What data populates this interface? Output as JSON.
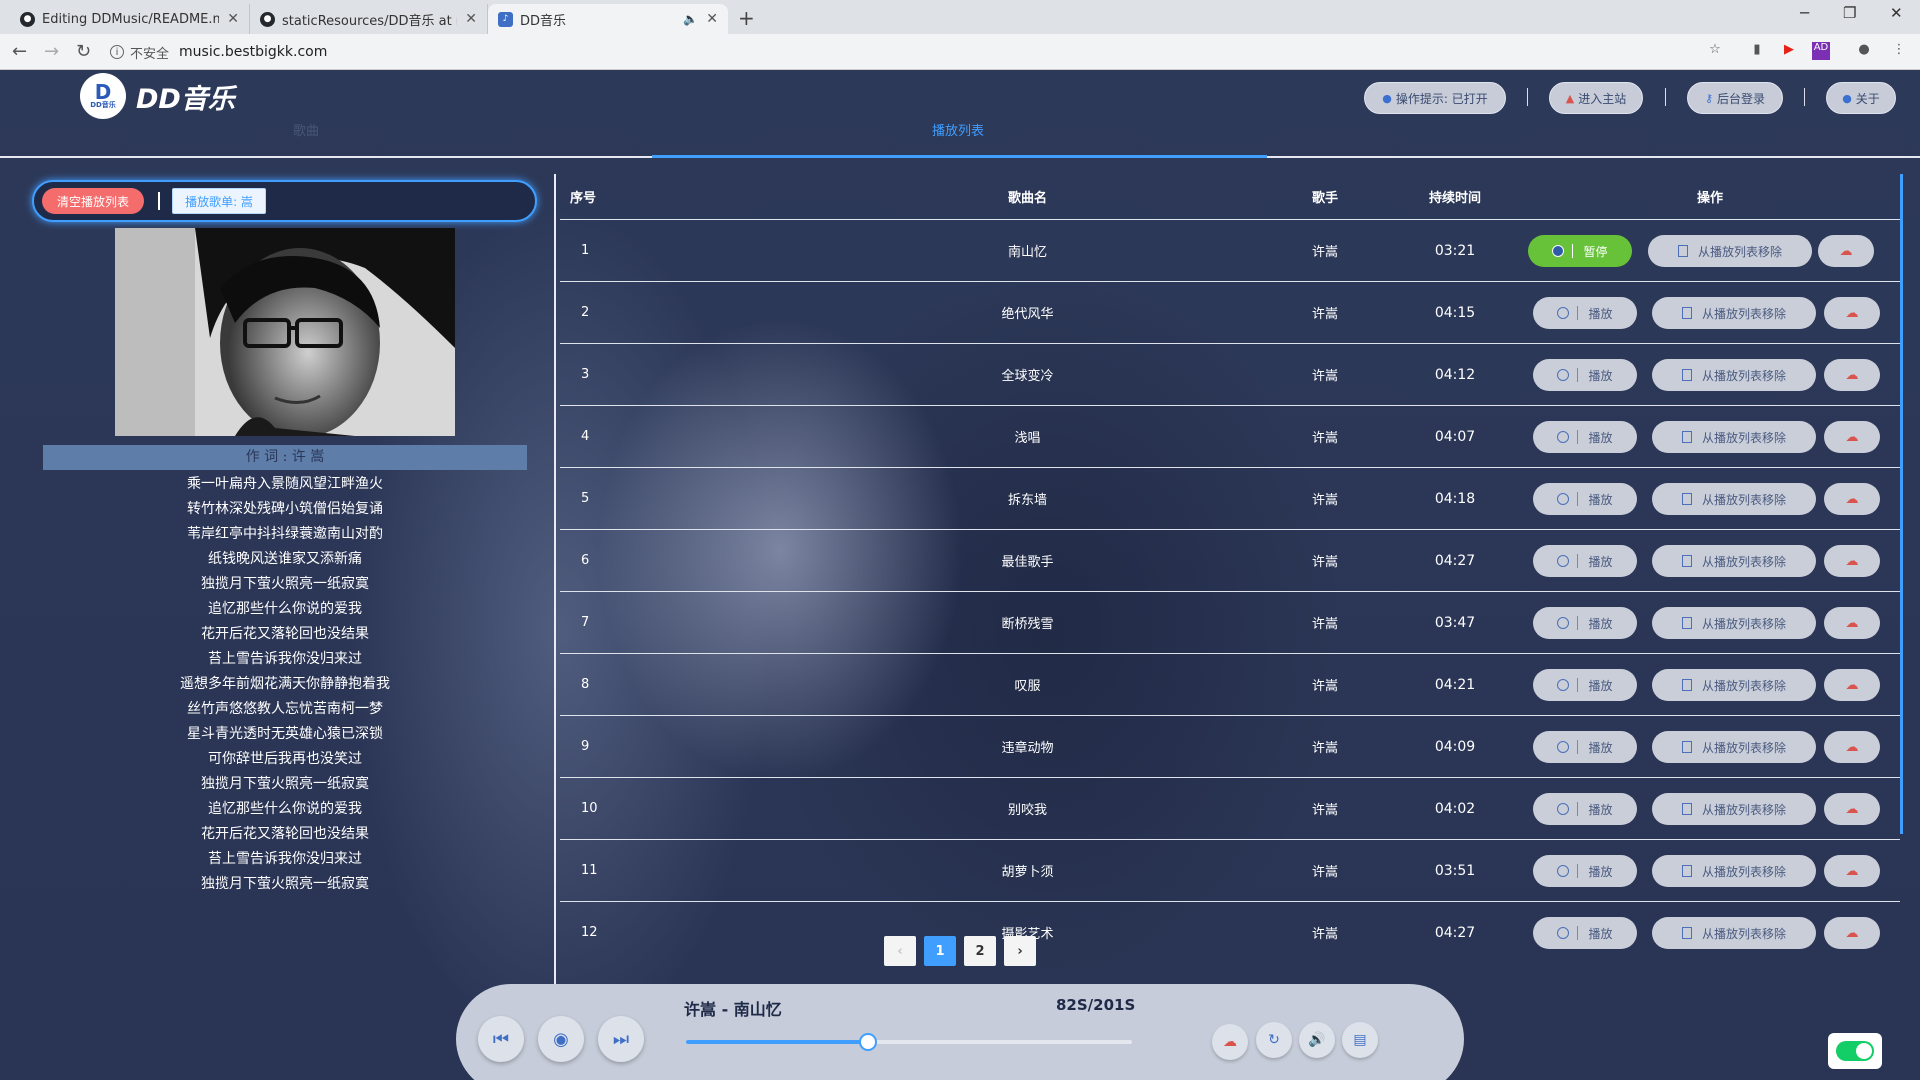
{
  "browser": {
    "tabs": [
      {
        "title": "Editing DDMusic/README.md at"
      },
      {
        "title": "staticResources/DD音乐 at maste"
      },
      {
        "title": "DD音乐"
      }
    ],
    "new_tab": "+",
    "insecure_label": "不安全",
    "url": "music.bestbigkk.com"
  },
  "header": {
    "logo_badge": "D",
    "logo_badge_small": "DD音乐",
    "logo_text": "DD音乐",
    "buttons": {
      "tips": "操作提示: 已打开",
      "main_site": "进入主站",
      "admin_login": "后台登录",
      "about": "关于"
    }
  },
  "nav": {
    "tab_lyrics": "歌曲",
    "tab_playlist": "播放列表"
  },
  "left": {
    "clear_button": "清空播放列表",
    "playlist_button": "播放歌单: 嵩",
    "lyric_header": "作 词 : 许 嵩",
    "lyrics": [
      "乘一叶扁舟入景随风望江畔渔火",
      "转竹林深处残碑小筑僧侣始复诵",
      "苇岸红亭中抖抖绿蓑邀南山对酌",
      "纸钱晚风送谁家又添新痛",
      "独揽月下萤火照亮一纸寂寞",
      "追忆那些什么你说的爱我",
      "花开后花又落轮回也没结果",
      "苔上雪告诉我你没归来过",
      "遥想多年前烟花满天你静静抱着我",
      "丝竹声悠悠教人忘忧苦南柯一梦",
      "星斗青光透时无英雄心猿已深锁",
      "可你辞世后我再也没笑过",
      "独揽月下萤火照亮一纸寂寞",
      "追忆那些什么你说的爱我",
      "花开后花又落轮回也没结果",
      "苔上雪告诉我你没归来过",
      "独揽月下萤火照亮一纸寂寞"
    ]
  },
  "table": {
    "headers": {
      "num": "序号",
      "name": "歌曲名",
      "singer": "歌手",
      "duration": "持续时间",
      "ops": "操作"
    },
    "play_label": "播放",
    "pause_label": "暂停",
    "remove_label": "从播放列表移除",
    "rows": [
      {
        "num": "1",
        "name": "南山忆",
        "singer": "许嵩",
        "duration": "03:21"
      },
      {
        "num": "2",
        "name": "绝代风华",
        "singer": "许嵩",
        "duration": "04:15"
      },
      {
        "num": "3",
        "name": "全球变冷",
        "singer": "许嵩",
        "duration": "04:12"
      },
      {
        "num": "4",
        "name": "浅唱",
        "singer": "许嵩",
        "duration": "04:07"
      },
      {
        "num": "5",
        "name": "拆东墙",
        "singer": "许嵩",
        "duration": "04:18"
      },
      {
        "num": "6",
        "name": "最佳歌手",
        "singer": "许嵩",
        "duration": "04:27"
      },
      {
        "num": "7",
        "name": "断桥残雪",
        "singer": "许嵩",
        "duration": "03:47"
      },
      {
        "num": "8",
        "name": "叹服",
        "singer": "许嵩",
        "duration": "04:21"
      },
      {
        "num": "9",
        "name": "违章动物",
        "singer": "许嵩",
        "duration": "04:09"
      },
      {
        "num": "10",
        "name": "别咬我",
        "singer": "许嵩",
        "duration": "04:02"
      },
      {
        "num": "11",
        "name": "胡萝卜须",
        "singer": "许嵩",
        "duration": "03:51"
      },
      {
        "num": "12",
        "name": "摄影艺术",
        "singer": "许嵩",
        "duration": "04:27"
      }
    ]
  },
  "pagination": {
    "prev": "‹",
    "pages": [
      "1",
      "2"
    ],
    "next": "›",
    "current": "1"
  },
  "player": {
    "now_playing": "许嵩 - 南山忆",
    "time": "82S/201S",
    "progress": 0.408
  },
  "colors": {
    "accent": "#409eff",
    "danger": "#f56c6c",
    "success": "#67c23a",
    "toggle": "#13ce66"
  }
}
